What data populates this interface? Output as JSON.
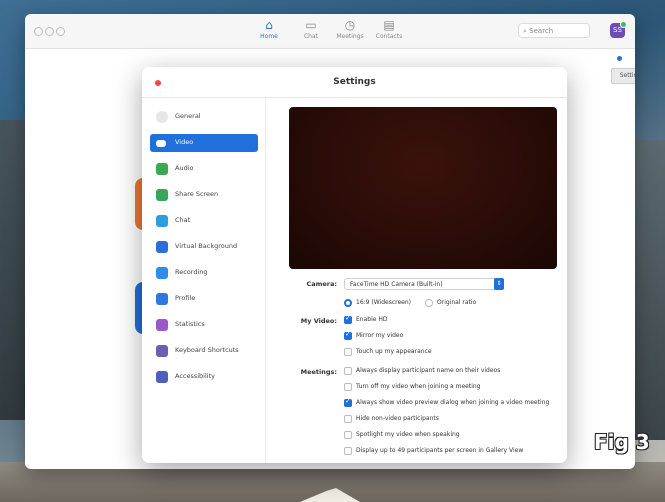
{
  "topbar": {
    "tabs": [
      {
        "label": "Home",
        "icon": "home-icon"
      },
      {
        "label": "Chat",
        "icon": "chat-icon"
      },
      {
        "label": "Meetings",
        "icon": "clock-icon"
      },
      {
        "label": "Contacts",
        "icon": "contacts-icon"
      }
    ],
    "search_placeholder": "Search",
    "avatar_initials": "SS",
    "tooltip": "Settings"
  },
  "settings": {
    "title": "Settings",
    "sidebar": [
      {
        "label": "General",
        "color": "#cfcfcf"
      },
      {
        "label": "Video",
        "color": "#ffffff"
      },
      {
        "label": "Audio",
        "color": "#3aaa52"
      },
      {
        "label": "Share Screen",
        "color": "#37a65a"
      },
      {
        "label": "Chat",
        "color": "#2b9ee0"
      },
      {
        "label": "Virtual Background",
        "color": "#2c6ed8"
      },
      {
        "label": "Recording",
        "color": "#2c8ee8"
      },
      {
        "label": "Profile",
        "color": "#2b79e0"
      },
      {
        "label": "Statistics",
        "color": "#9b59c8"
      },
      {
        "label": "Keyboard Shortcuts",
        "color": "#6a5fb0"
      },
      {
        "label": "Accessibility",
        "color": "#4f5fbf"
      }
    ],
    "camera_label": "Camera:",
    "camera_value": "FaceTime HD Camera (Built-in)",
    "aspect_16_9": "16:9 (Widescreen)",
    "aspect_original": "Original ratio",
    "my_video_label": "My Video:",
    "my_video_options": [
      {
        "label": "Enable HD",
        "checked": true
      },
      {
        "label": "Mirror my video",
        "checked": true
      },
      {
        "label": "Touch up my appearance",
        "checked": false
      }
    ],
    "meetings_label": "Meetings:",
    "meetings_options": [
      {
        "label": "Always display participant name on their videos",
        "checked": false
      },
      {
        "label": "Turn off my video when joining a meeting",
        "checked": false
      },
      {
        "label": "Always show video preview dialog when joining a video meeting",
        "checked": true
      },
      {
        "label": "Hide non-video participants",
        "checked": false
      },
      {
        "label": "Spotlight my video when speaking",
        "checked": false
      },
      {
        "label": "Display up to 49 participants per screen in Gallery View",
        "checked": false
      }
    ]
  },
  "figure_label": "Fig 3",
  "colors": {
    "accent": "#1f6fdc",
    "close": "#ef4c41"
  }
}
